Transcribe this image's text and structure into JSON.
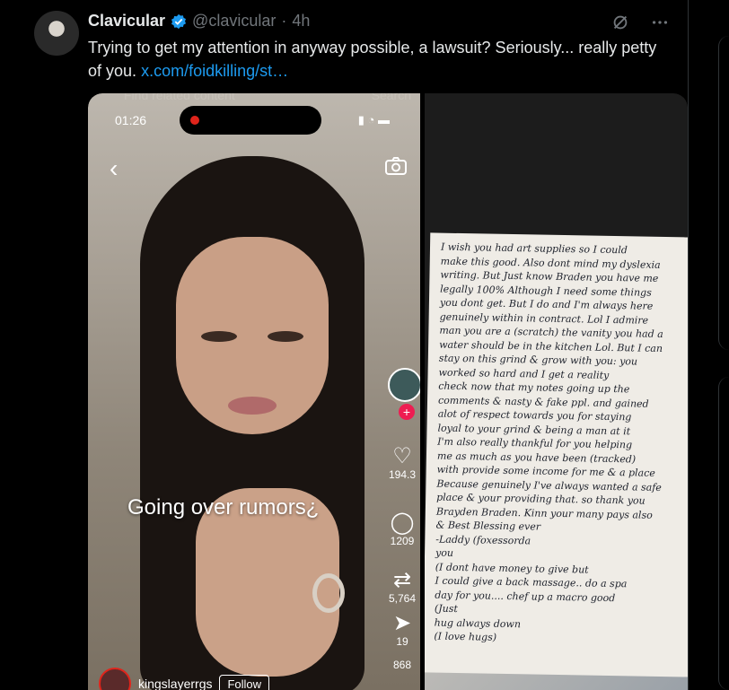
{
  "post": {
    "author_name": "Clavicular",
    "author_handle": "@clavicular",
    "separator": "·",
    "timestamp": "4h",
    "text": "Trying to get my attention in anyway possible, a lawsuit? Seriously... really petty of you.",
    "link": "x.com/foidkilling/st…"
  },
  "icons": {
    "verified": "verified-badge-icon",
    "grok": "grok-icon",
    "more": "more-icon"
  },
  "colors": {
    "accent": "#1d9bf0",
    "live_dot": "#e0241b",
    "tiktok_plus": "#ee1d52"
  },
  "video": {
    "search_placeholder": "Find related content",
    "search_button": "Search",
    "time": "01:26",
    "caption": "Going over rumors¿",
    "likes": "194.3",
    "comments": "1209",
    "shares": "5,764",
    "saves": "19",
    "extra": "868",
    "username": "kingslayerrgs",
    "follow": "Follow"
  },
  "letter": {
    "lines": "I wish you had art supplies so I could\nmake this good. Also dont mind my dyslexia\nwriting. But Just know Braden you have me\nlegally 100% Although I need some things\nyou dont get. But I do and I'm always here\ngenuinely within in contract. Lol I admire\nman you are a (scratch) the vanity you had a\nwater should be in the kitchen Lol. But I can\nstay on this grind & grow with you: you\nworked so hard and I get a reality\ncheck now that my notes going up the\ncomments & nasty & fake ppl. and gained\nalot of respect towards you for staying\nloyal to your grind & being a man at it\nI'm also really thankful for you helping\nme as much as you have been (tracked)\nwith provide some income for me & a place\nBecause genuinely I've always wanted a safe\nplace & your providing that. so thank you\nBrayden Braden. Kinn your many pays also\n& Best Blessing ever\n-Laddy (foxessorda\nyou\n(I dont have money to give but\nI could give a back massage.. do a spa\nday for you.... chef up a macro good\n(Just\nhug always down\n(I love hugs)"
  }
}
